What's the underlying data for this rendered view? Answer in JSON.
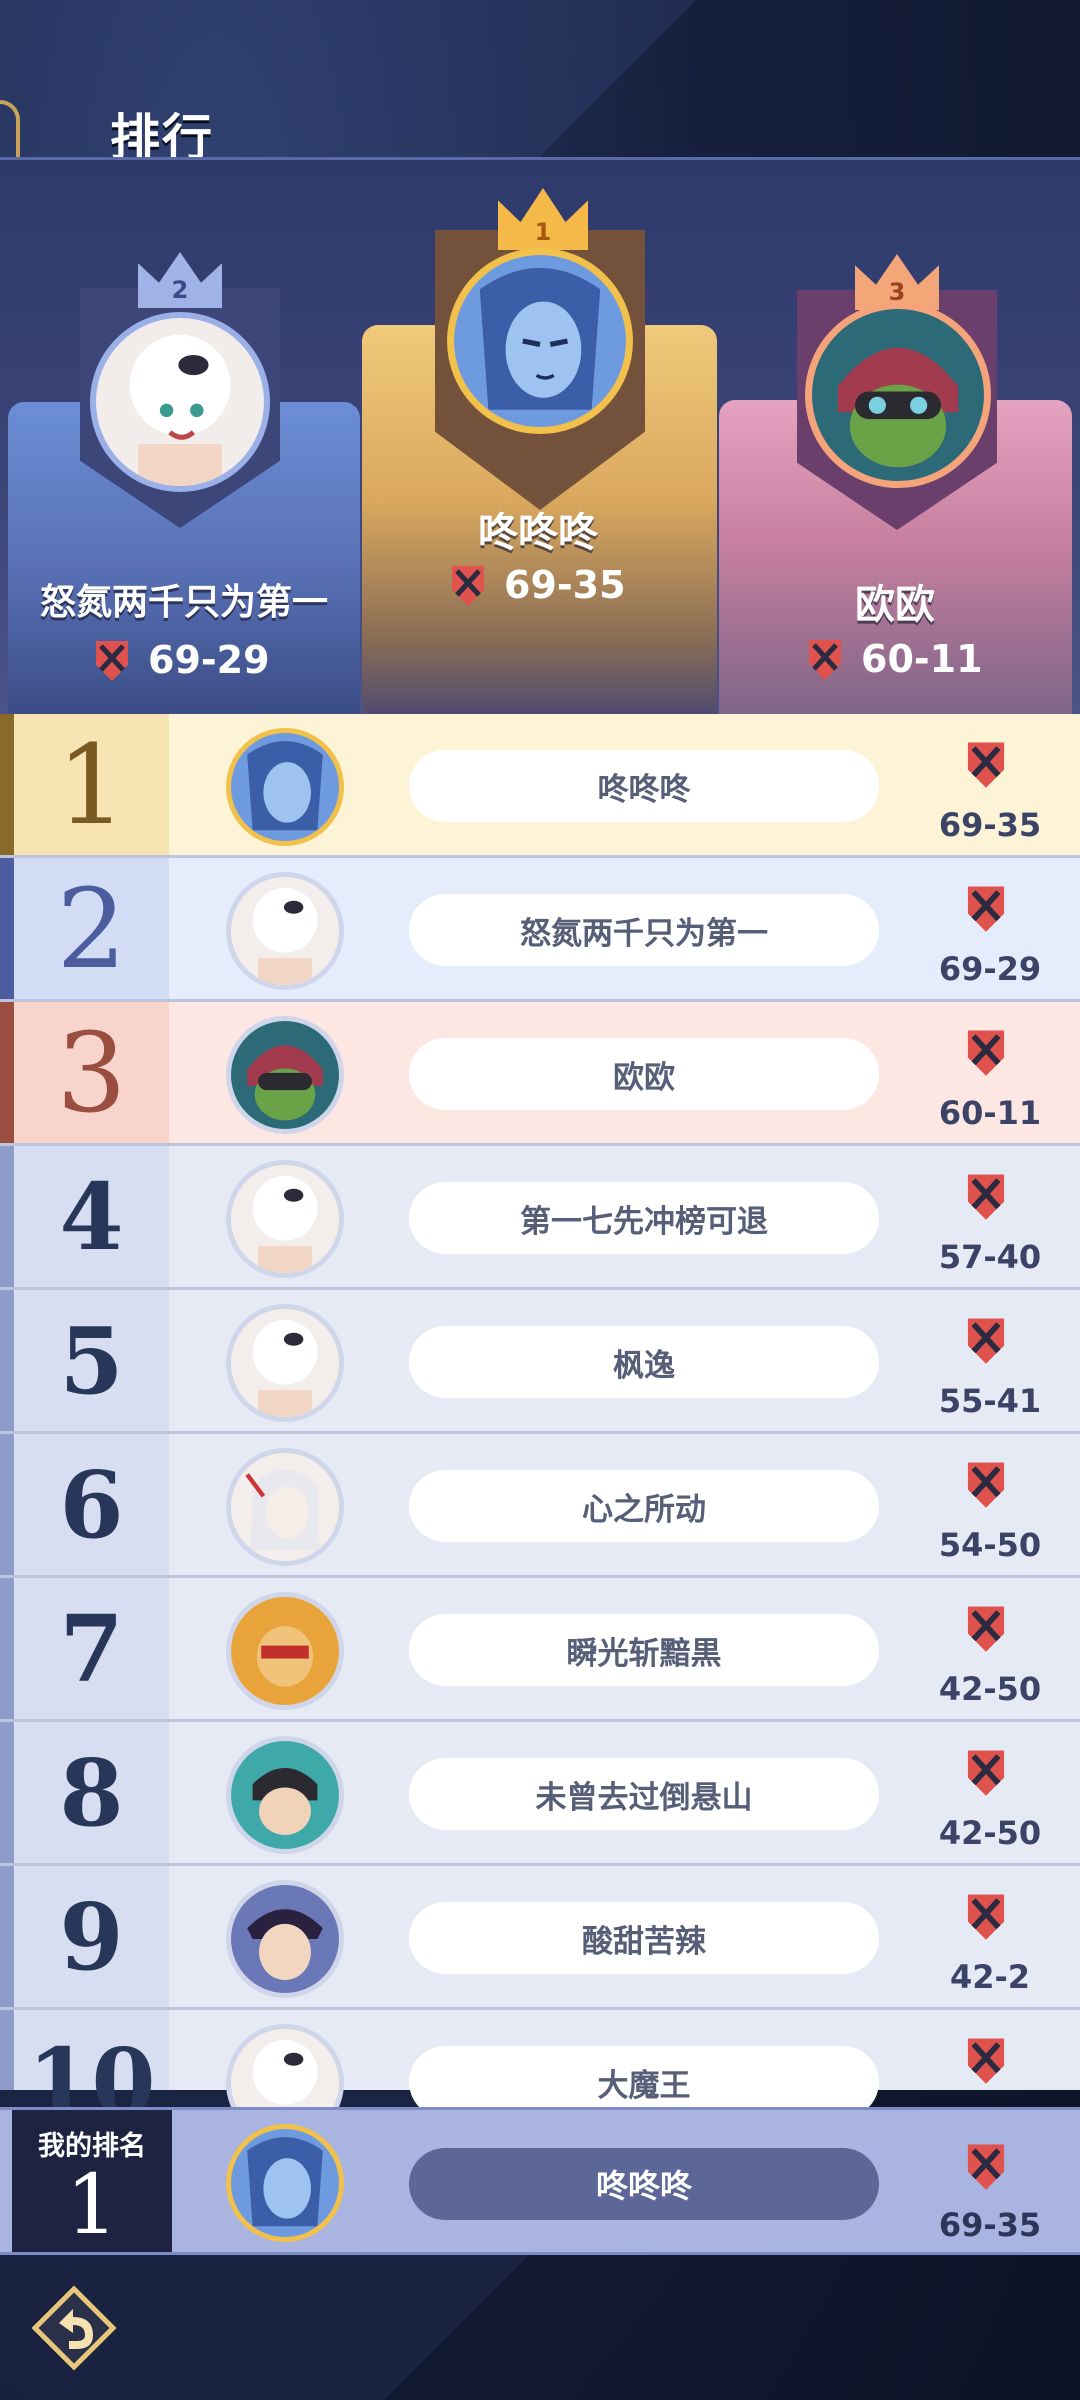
{
  "header": {
    "title": "排行"
  },
  "podium": [
    {
      "place": "2",
      "name": "怒氮两千只为第一",
      "score": "69-29"
    },
    {
      "place": "1",
      "name": "咚咚咚",
      "score": "69-35"
    },
    {
      "place": "3",
      "name": "欧欧",
      "score": "60-11"
    }
  ],
  "rankings": [
    {
      "rank": "1",
      "name": "咚咚咚",
      "score": "69-35"
    },
    {
      "rank": "2",
      "name": "怒氮两千只为第一",
      "score": "69-29"
    },
    {
      "rank": "3",
      "name": "欧欧",
      "score": "60-11"
    },
    {
      "rank": "4",
      "name": "第一七先冲榜可退",
      "score": "57-40"
    },
    {
      "rank": "5",
      "name": "枫逸",
      "score": "55-41"
    },
    {
      "rank": "6",
      "name": "心之所动",
      "score": "54-50"
    },
    {
      "rank": "7",
      "name": "瞬光斩黯黒",
      "score": "42-50"
    },
    {
      "rank": "8",
      "name": "未曾去过倒悬山",
      "score": "42-50"
    },
    {
      "rank": "9",
      "name": "酸甜苦辣",
      "score": "42-2"
    },
    {
      "rank": "10",
      "name": "大魔王",
      "score": ""
    }
  ],
  "my_rank": {
    "label": "我的排名",
    "rank": "1",
    "name": "咚咚咚",
    "score": "69-35"
  },
  "icons": {
    "badge": "crossed-swords-shield-icon",
    "back": "back-arrow-icon"
  },
  "colors": {
    "gold": "#f2c14c",
    "silver": "#9cb0e8",
    "bronze": "#f5a37a"
  }
}
